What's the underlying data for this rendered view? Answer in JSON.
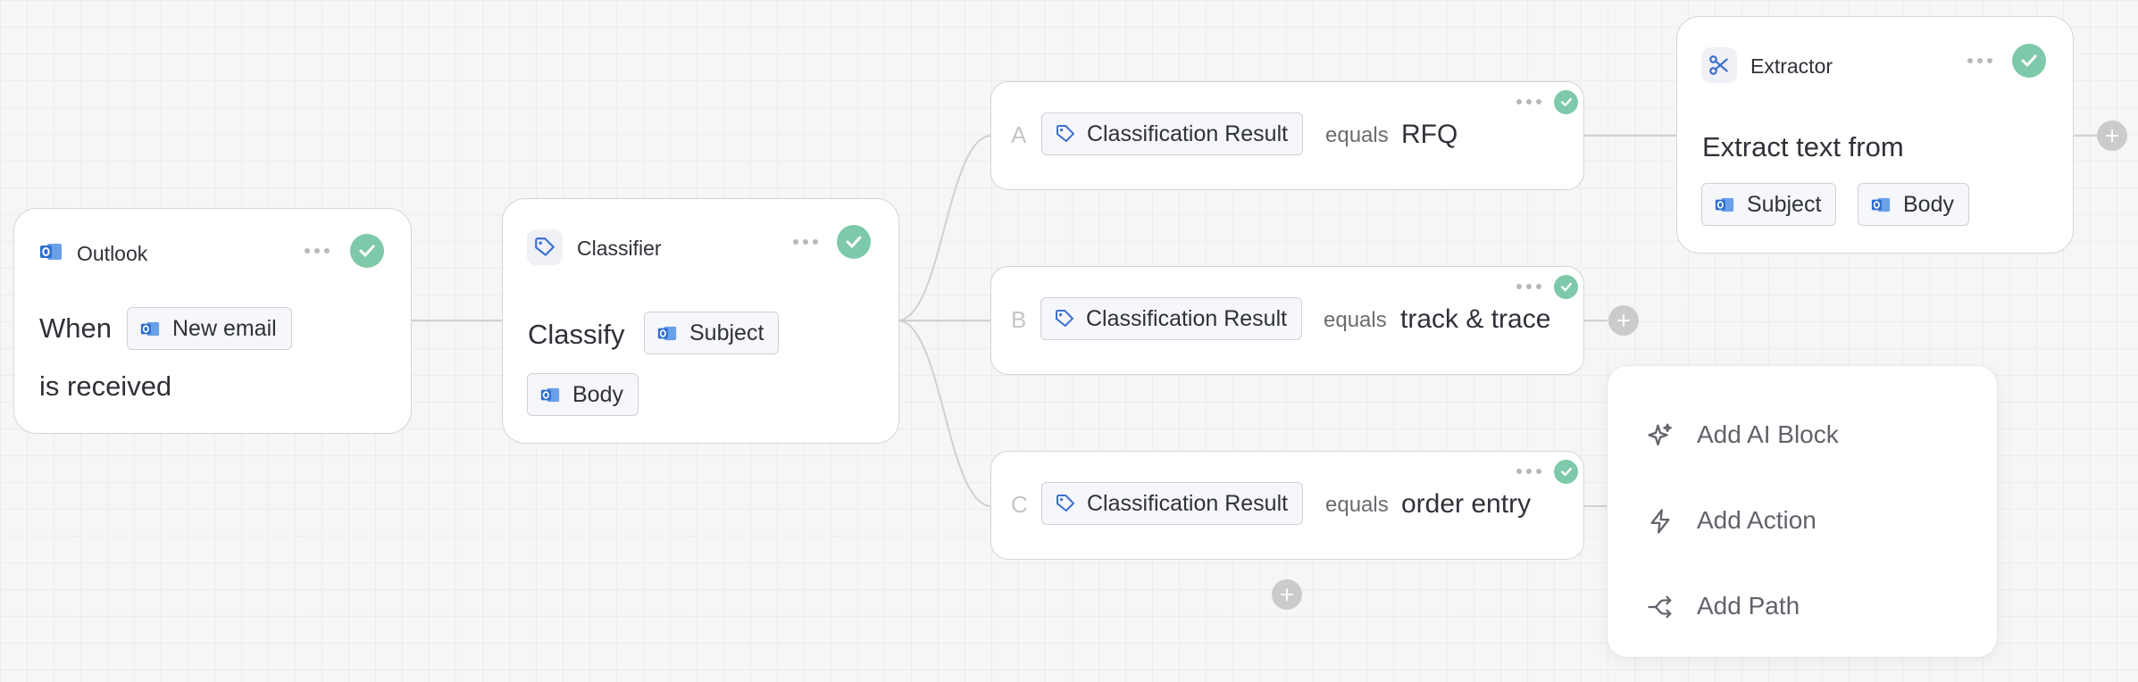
{
  "nodes": {
    "outlook": {
      "title": "Outlook",
      "text_before": "When",
      "chip_label": "New email",
      "text_after": "is received",
      "icon": "outlook-icon",
      "status": "complete"
    },
    "classifier": {
      "title": "Classifier",
      "text_before": "Classify",
      "inputs": [
        "Subject",
        "Body"
      ],
      "icon": "tag-icon",
      "status": "complete"
    },
    "extractor": {
      "title": "Extractor",
      "text": "Extract text from",
      "inputs": [
        "Subject",
        "Body"
      ],
      "icon": "scissors-icon",
      "status": "complete"
    }
  },
  "paths": [
    {
      "letter": "A",
      "field": "Classification Result",
      "operator": "equals",
      "value": "RFQ",
      "status": "complete"
    },
    {
      "letter": "B",
      "field": "Classification Result",
      "operator": "equals",
      "value": "track & trace",
      "status": "complete"
    },
    {
      "letter": "C",
      "field": "Classification Result",
      "operator": "equals",
      "value": "order entry",
      "status": "complete"
    }
  ],
  "add_menu": {
    "items": [
      {
        "label": "Add AI Block",
        "icon": "sparkle-icon"
      },
      {
        "label": "Add Action",
        "icon": "lightning-icon"
      },
      {
        "label": "Add Path",
        "icon": "split-path-icon"
      }
    ]
  },
  "colors": {
    "check_green": "#7ec9a9",
    "outlook_blue": "#2f6fd0",
    "tag_blue": "#3b6fd1",
    "connector": "#d0d1cf",
    "plus_gray": "#cbcbcb"
  }
}
